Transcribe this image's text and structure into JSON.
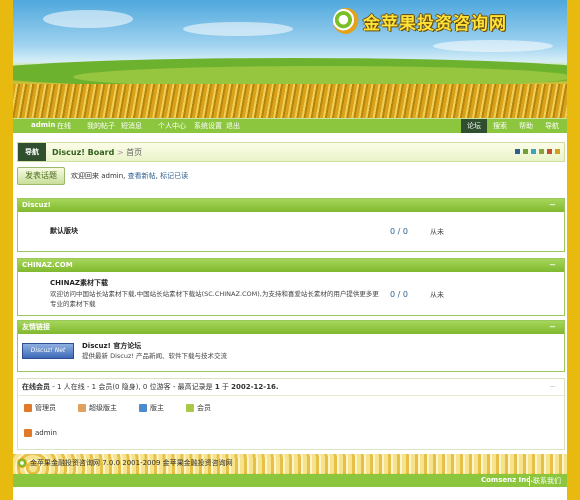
{
  "site": {
    "title": "金苹果投资咨询网"
  },
  "nav": {
    "left": {
      "user": "admin",
      "status": "在线",
      "items": [
        "我的帖子",
        "短消息",
        "个人中心",
        "系统设置",
        "退出"
      ]
    },
    "right": [
      "论坛",
      "搜索",
      "帮助",
      "导航"
    ]
  },
  "breadcrumb": {
    "label": "导航",
    "forum": "Discuz! Board",
    "separator": ">",
    "current": "首页"
  },
  "style_swatches": [
    "#2f5f8f",
    "#6f9f3f",
    "#3fa0c0",
    "#8fa040",
    "#c05030",
    "#d0a020"
  ],
  "post_button": "发表话题",
  "welcome": {
    "greeting": "欢迎回来",
    "user": "admin,",
    "new_posts": "查看新帖",
    "sep": ",",
    "mark_read": "标记已读"
  },
  "sections": [
    {
      "title": "Discuz!",
      "toggle": "－",
      "forums": [
        {
          "name": "默认版块",
          "description": "",
          "count": "0 / 0",
          "last": "从未"
        }
      ]
    },
    {
      "title": "CHINAZ.COM",
      "toggle": "－",
      "forums": [
        {
          "name": "CHINAZ素材下载",
          "description": "欢迎访问中国站长站素材下载,中国站长站素材下载站(SC.CHINAZ.COM),为支持和喜爱站长素材的用户提供更多更专业的素材下载",
          "count": "0 / 0",
          "last": "从未"
        }
      ]
    },
    {
      "title": "友情链接",
      "toggle": "－",
      "links": [
        {
          "logo": "Discuz! Net",
          "name": "Discuz! 官方论坛",
          "description": "提供最新 Discuz! 产品新闻、软件下载与技术交流"
        }
      ]
    }
  ],
  "online": {
    "title": "在线会员",
    "summary": "- 1 人在线 - 1 会员(0 隐身), 0 位游客 - 最高记录是",
    "record": "1",
    "record_on": "于",
    "record_date": "2002-12-16.",
    "toggle": "－",
    "legend": [
      {
        "label": "管理员",
        "color": "#e07a2a"
      },
      {
        "label": "超级版主",
        "color": "#e0a060"
      },
      {
        "label": "版主",
        "color": "#4a8acd"
      },
      {
        "label": "会员",
        "color": "#a8c84a"
      }
    ],
    "members": [
      {
        "name": "admin",
        "color": "#e07a2a"
      }
    ]
  },
  "footer": {
    "copyright": "金苹果金融投资咨询网 7.0.0 2001-2009 金苹果金融投资咨询网",
    "brand": "Comsenz Inc.",
    "contact": "联系我们"
  }
}
